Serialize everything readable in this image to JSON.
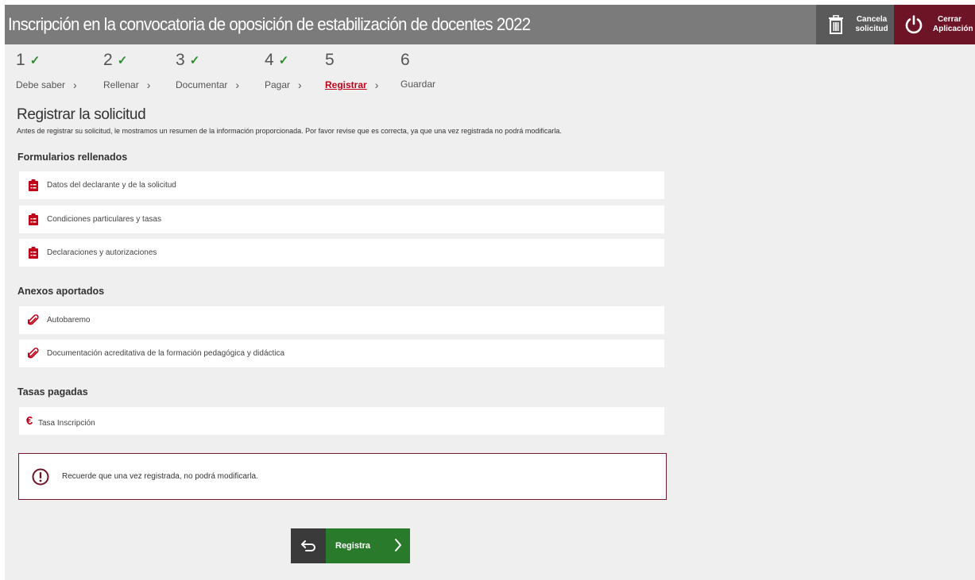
{
  "header": {
    "title": "Inscripción en la convocatoria de oposición de estabilización de docentes 2022",
    "cancel_label_1": "Cancela",
    "cancel_label_2": "solicitud",
    "close_label_1": "Cerrar",
    "close_label_2": "Aplicación"
  },
  "steps": [
    {
      "num": "1",
      "check": "✓",
      "label": "Debe saber",
      "chev": "›"
    },
    {
      "num": "2",
      "check": "✓",
      "label": "Rellenar",
      "chev": "›"
    },
    {
      "num": "3",
      "check": "✓",
      "label": "Documentar",
      "chev": "›"
    },
    {
      "num": "4",
      "check": "✓",
      "label": "Pagar",
      "chev": "›"
    },
    {
      "num": "5",
      "check": "",
      "label": "Registrar",
      "chev": "›"
    },
    {
      "num": "6",
      "check": "",
      "label": "Guardar",
      "chev": ""
    }
  ],
  "main": {
    "title": "Registrar la solicitud",
    "description": "Antes de registrar su solicitud, le mostramos un resumen de la información proporcionada. Por favor revise que es correcta, ya que una vez registrada no podrá modificarla.",
    "forms_title": "Formularios rellenados",
    "forms": [
      "Datos del declarante y de la solicitud",
      "Condiciones particulares y tasas",
      "Declaraciones y autorizaciones"
    ],
    "annexes_title": "Anexos aportados",
    "annexes": [
      "Autobaremo",
      "Documentación acreditativa de la formación pedagógica y didáctica"
    ],
    "fees_title": "Tasas pagadas",
    "fees": [
      "Tasa Inscripción"
    ],
    "fee_symbol": "€",
    "alert": "Recuerde que una vez registrada, no podrá modificarla.",
    "submit_label": "Registra"
  },
  "colors": {
    "header_bg": "#7b7b7b",
    "close_bg": "#6d1426",
    "accent_red": "#c00018",
    "submit_green": "#2a7a2c",
    "check_green": "#2e8b2e"
  }
}
